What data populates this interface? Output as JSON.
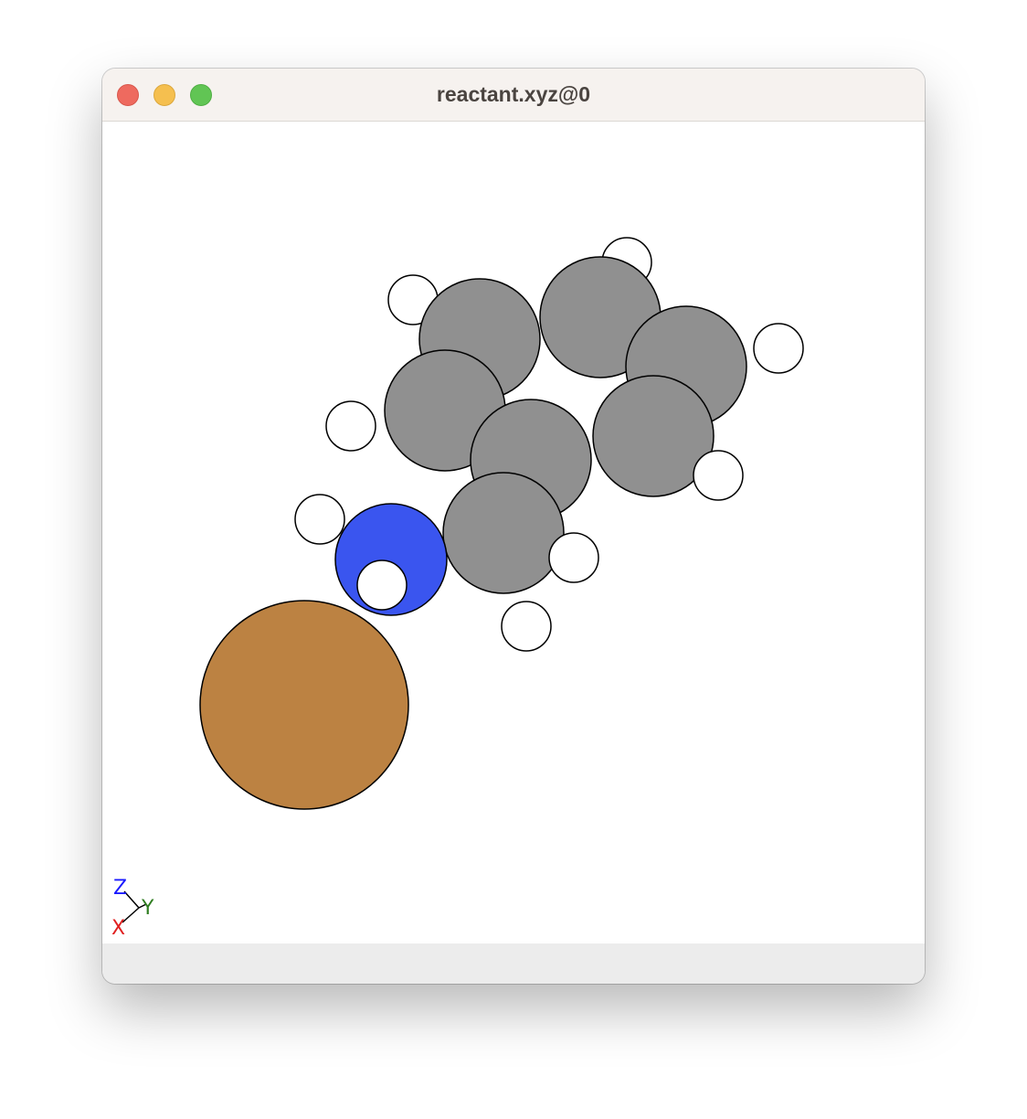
{
  "window": {
    "title": "reactant.xyz@0",
    "buttons": [
      {
        "name": "close-button",
        "color": "#ee6a5f"
      },
      {
        "name": "minimize-button",
        "color": "#f5bf4f"
      },
      {
        "name": "zoom-button",
        "color": "#61c554"
      }
    ]
  },
  "colors": {
    "hydrogen": "#ffffff",
    "carbon": "#909090",
    "nitrogen": "#3a55ef",
    "copper": "#bc8242"
  },
  "axes": {
    "z_label": "Z",
    "y_label": "Y",
    "x_label": "X",
    "z_color": "#1a1aff",
    "y_color": "#2e7d1f",
    "x_color": "#e02020"
  }
}
